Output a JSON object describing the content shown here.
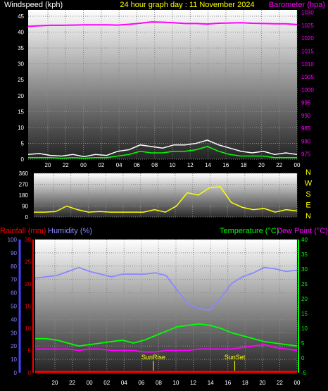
{
  "header": {
    "left": "Windspeed (kph)",
    "center": "24 hour graph day : 11 November 2024",
    "right": "Barometer (hpa)"
  },
  "colors": {
    "wind": "#ffffff",
    "gust": "#00ff00",
    "baro": "#ff00ff",
    "dir": "#ffff00",
    "humidity": "#8888ff",
    "temperature": "#00ff00",
    "dewpoint": "#ff00ff",
    "rain": "#ff0000",
    "sun": "#ffff00"
  },
  "x_ticks": [
    "20",
    "22",
    "00",
    "02",
    "04",
    "06",
    "08",
    "10",
    "12",
    "14",
    "16",
    "18",
    "20",
    "22",
    "00"
  ],
  "chart_data": [
    {
      "type": "line",
      "title": "24 hour graph day : 11 November 2024",
      "ylabel_left": "Windspeed (kph)",
      "ylabel_right": "Barometer (hpa)",
      "left_ticks": [
        "45",
        "40",
        "35",
        "30",
        "25",
        "20",
        "15",
        "10",
        "5",
        "0"
      ],
      "right_ticks": [
        "1030",
        "1025",
        "1020",
        "1015",
        "1010",
        "1005",
        "1000",
        "995",
        "990",
        "985",
        "980",
        "975"
      ],
      "ylim_left": [
        0,
        47
      ],
      "ylim_right": [
        973,
        1031
      ],
      "series": [
        {
          "name": "Barometer",
          "axis": "right",
          "values": [
            1024.6,
            1024.8,
            1025.0,
            1025.0,
            1025.1,
            1025.2,
            1025.2,
            1025.2,
            1025.1,
            1025.4,
            1025.8,
            1026.3,
            1026.2,
            1026.0,
            1025.7,
            1025.7,
            1025.5,
            1025.8,
            1025.9,
            1026.0,
            1025.8,
            1025.7,
            1025.6,
            1025.6,
            1025.3
          ]
        },
        {
          "name": "Wind",
          "axis": "left",
          "values": [
            1.5,
            1.8,
            1.2,
            1.0,
            1.5,
            0.8,
            1.5,
            1.2,
            2.5,
            3.0,
            4.5,
            4.0,
            3.5,
            4.5,
            4.5,
            5.0,
            6.0,
            4.5,
            3.5,
            2.5,
            2.0,
            2.5,
            1.5,
            2.0,
            1.5
          ]
        },
        {
          "name": "Gust",
          "axis": "left",
          "values": [
            0.5,
            0.5,
            0.5,
            0.3,
            0.5,
            0.3,
            0.5,
            0.5,
            1.0,
            1.5,
            2.5,
            2.0,
            2.0,
            2.5,
            2.5,
            3.0,
            4.0,
            2.5,
            1.5,
            1.0,
            1.0,
            1.0,
            0.5,
            0.5,
            0.5
          ]
        }
      ]
    },
    {
      "type": "line",
      "ylabel_right": "N W S E N",
      "left_ticks": [
        "360",
        "270",
        "180",
        "90",
        "0"
      ],
      "ylim": [
        0,
        360
      ],
      "compass": [
        "N",
        "W",
        "S",
        "E",
        "N"
      ],
      "series": [
        {
          "name": "Direction",
          "values": [
            40,
            40,
            45,
            90,
            60,
            40,
            45,
            40,
            40,
            40,
            40,
            60,
            40,
            90,
            200,
            180,
            240,
            250,
            120,
            80,
            60,
            70,
            40,
            60,
            50
          ]
        }
      ]
    },
    {
      "type": "line",
      "left_label_1": "Rainfall (mm)",
      "left_label_2": "Humidity (%)",
      "right_label_1": "Temperature (°C)",
      "right_label_2": "Dew Point (°C)",
      "humidity_ticks": [
        "100",
        "90",
        "80",
        "70",
        "60",
        "50",
        "40",
        "30",
        "20",
        "10",
        "0"
      ],
      "rain_ticks": [
        "30",
        "25",
        "20",
        "15",
        "10",
        "5",
        "0"
      ],
      "temp_ticks": [
        "40",
        "35",
        "30",
        "25",
        "20",
        "15",
        "10",
        "5",
        "0",
        "-5"
      ],
      "ylim_humidity": [
        0,
        100
      ],
      "ylim_rain": [
        0,
        30
      ],
      "ylim_temp": [
        -5,
        40
      ],
      "annotations": [
        "SunRise",
        "SunSet"
      ],
      "sunrise_hour": 7.4,
      "sunset_hour": 16.8,
      "series": [
        {
          "name": "Humidity",
          "values": [
            71,
            72,
            73,
            76,
            79,
            76,
            74,
            72,
            74,
            74,
            74,
            75,
            73,
            62,
            52,
            48,
            47,
            56,
            67,
            72,
            75,
            79,
            78,
            76,
            77
          ]
        },
        {
          "name": "Temperature",
          "values": [
            6.5,
            6.5,
            6.0,
            5.0,
            4.0,
            4.5,
            5.0,
            5.5,
            6.0,
            5.0,
            6.0,
            7.5,
            9.0,
            10.5,
            11.0,
            11.5,
            11.0,
            10.0,
            8.5,
            7.5,
            6.5,
            5.5,
            5.0,
            4.5,
            4.0
          ]
        },
        {
          "name": "Dew Point",
          "values": [
            3.0,
            3.0,
            3.0,
            3.0,
            2.5,
            3.0,
            3.0,
            2.5,
            2.5,
            2.5,
            2.0,
            2.0,
            2.5,
            2.5,
            2.5,
            3.0,
            3.0,
            3.0,
            3.0,
            3.5,
            4.0,
            4.5,
            3.5,
            3.0,
            2.5
          ]
        },
        {
          "name": "Rainfall",
          "values": [
            0,
            0,
            0,
            0,
            0,
            0,
            0,
            0,
            0,
            0,
            0,
            0,
            0,
            0,
            0,
            0,
            0,
            0,
            0,
            0,
            0,
            0,
            0,
            0,
            0
          ]
        }
      ]
    }
  ]
}
